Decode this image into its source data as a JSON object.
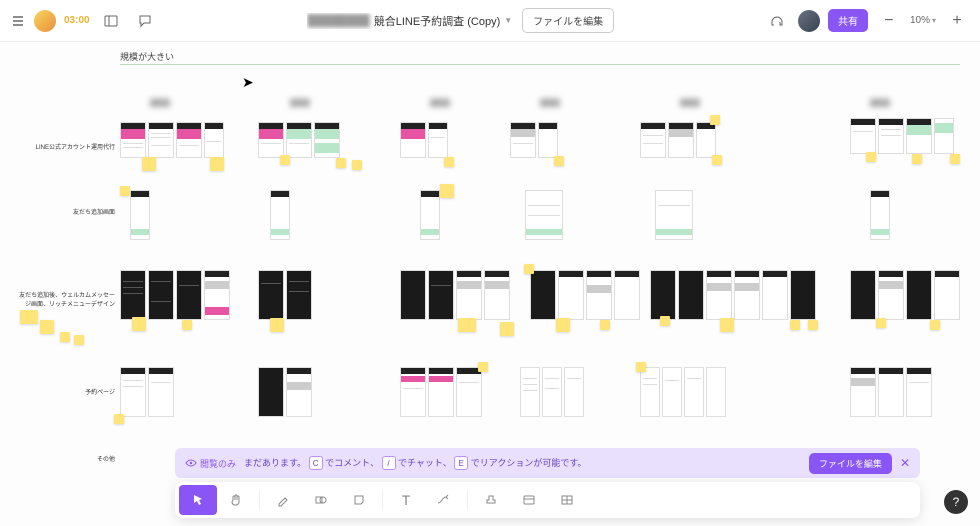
{
  "header": {
    "timer": "03:00",
    "doc_title_suffix": "競合LINE予約調査 (Copy)",
    "edit_file_label": "ファイルを編集",
    "share_label": "共有",
    "zoom_value": "10%"
  },
  "canvas": {
    "section_label": "規模が大きい",
    "column_heads": [
      "—",
      "—",
      "—",
      "—",
      "—",
      "—"
    ],
    "row_labels": {
      "r1": "LINE公式アカウント運用代行",
      "r2": "友だち追加画面",
      "r3": "友だち追加後、ウェルカムメッセージ画面、リッチメニューデザイン",
      "r4": "予約ページ",
      "r5": "その他"
    }
  },
  "banner": {
    "tag_label": "閲覧のみ",
    "msg_prefix": "まだあります。",
    "key_c": "C",
    "msg_c": "でコメント、",
    "key_slash": "/",
    "msg_slash": "でチャット、",
    "key_e": "E",
    "msg_e": "でリアクションが可能です。",
    "action_label": "ファイルを編集"
  },
  "toolbar": {
    "tools": [
      "pointer",
      "hand",
      "pen",
      "shapes",
      "sticky",
      "text",
      "connector",
      "stamp",
      "table",
      "grid"
    ]
  }
}
